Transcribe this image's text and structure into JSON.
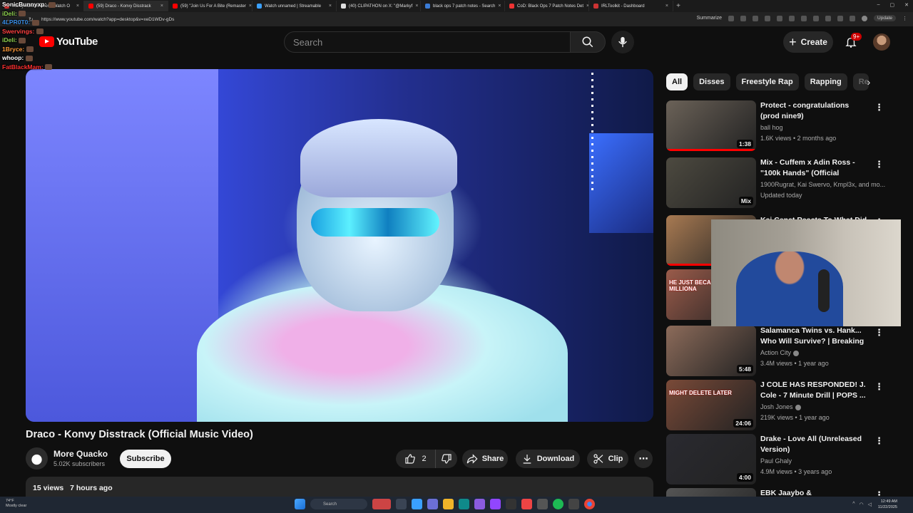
{
  "browser": {
    "tabs": [
      {
        "label": "Markymarks Videos - Watch O",
        "color": "#d33"
      },
      {
        "label": "(59) Draco - Konvy Disstrack",
        "color": "#f00",
        "active": true
      },
      {
        "label": "(59) \"Join Us For A Bite (Remaster",
        "color": "#f00"
      },
      {
        "label": "Watch unnamed | Streamable",
        "color": "#3aa0ff"
      },
      {
        "label": "(40) CLIPATHON on X: \"@Markyf",
        "color": "#ddd"
      },
      {
        "label": "black ops 7 patch notes - Search",
        "color": "#3a7bd5"
      },
      {
        "label": "CoD: Black Ops 7 Patch Notes Det",
        "color": "#e33"
      },
      {
        "label": "IRLToolkit - Dashboard",
        "color": "#c33"
      }
    ],
    "url": "https://www.youtube.com/watch?app=desktop&v=xeD1WDv-gDs",
    "summarize_label": "Summarize",
    "update_label": "Update"
  },
  "chat": [
    {
      "name": "SonicBunnyxp:",
      "color": "#ffffff"
    },
    {
      "name": "iDeli:",
      "color": "#8fd14f"
    },
    {
      "name": "4LPR0T0:",
      "color": "#3a8ee6"
    },
    {
      "name": "Swervings:",
      "color": "#ff4040"
    },
    {
      "name": "iDeli:",
      "color": "#8fd14f"
    },
    {
      "name": "1Bryce:",
      "color": "#ff9a3a"
    },
    {
      "name": "whoop:",
      "color": "#ffffff"
    },
    {
      "name": "FatBlackMam:",
      "color": "#ff3030"
    }
  ],
  "header": {
    "logo_text": "YouTube",
    "search_placeholder": "Search",
    "create_label": "Create",
    "notification_badge": "9+"
  },
  "video": {
    "title": "Draco - Konvy Disstrack (Official Music Video)",
    "channel_name": "More Quacko",
    "channel_subs": "5.02K subscribers",
    "subscribe_label": "Subscribe",
    "like_count": "2",
    "share_label": "Share",
    "download_label": "Download",
    "clip_label": "Clip",
    "views": "15 views",
    "age": "7 hours ago"
  },
  "chips": [
    "All",
    "Disses",
    "Freestyle Rap",
    "Rapping",
    "Re"
  ],
  "recommendations": [
    {
      "title": "Protect - congratulations (prod nine9)",
      "channel": "ball hog",
      "meta": "1.6K views • 2 months ago",
      "duration": "1:38",
      "progress": 1.0,
      "thumb": "#6b6258"
    },
    {
      "title": "Mix - Cuffem x Adin Ross - \"100k Hands\" (Official Unmixe...",
      "channel": "1900Rugrat, Kai Swervo, Kmpl3x, and mo...",
      "meta": "Updated today",
      "duration": "Mix",
      "progress": 0,
      "thumb": "#4d4a40"
    },
    {
      "title": "Kai Cenat Reacts To What Did I...",
      "channel": "",
      "meta": "",
      "duration": "",
      "progress": 0.5,
      "thumb": "#a87a52"
    },
    {
      "title": "",
      "channel": "",
      "meta": "",
      "duration": "",
      "progress": 0,
      "thumb": "#9a5b4a",
      "thumb_text": "HE JUST BECA A MILLIONA"
    },
    {
      "title": "Salamanca Twins vs. Hank... Who Will Survive? | Breaking ...",
      "channel": "Action City",
      "meta": "3.4M views • 1 year ago",
      "duration": "5:48",
      "progress": 0,
      "thumb": "#8c6b5a",
      "verified": true
    },
    {
      "title": "J COLE HAS RESPONDED! J. Cole - 7 Minute Drill | POPS ...",
      "channel": "Josh Jones",
      "meta": "219K views • 1 year ago",
      "duration": "24:06",
      "progress": 0,
      "thumb": "#7a4a38",
      "verified": true,
      "thumb_text": "MIGHT DELETE LATER"
    },
    {
      "title": "Drake - Love All (Unreleased Version)",
      "channel": "Paul Ghaly",
      "meta": "4.9M views • 3 years ago",
      "duration": "4:00",
      "progress": 0,
      "thumb": "#2a2a30"
    },
    {
      "title": "EBK Jaaybo & PlagueBoyMax...",
      "channel": "",
      "meta": "",
      "duration": "",
      "progress": 0,
      "thumb": "#555"
    }
  ],
  "taskbar": {
    "weather_temp": "74°F",
    "weather_desc": "Mostly clear",
    "search_label": "Search",
    "time": "12:49 AM",
    "date": "11/22/2025"
  }
}
